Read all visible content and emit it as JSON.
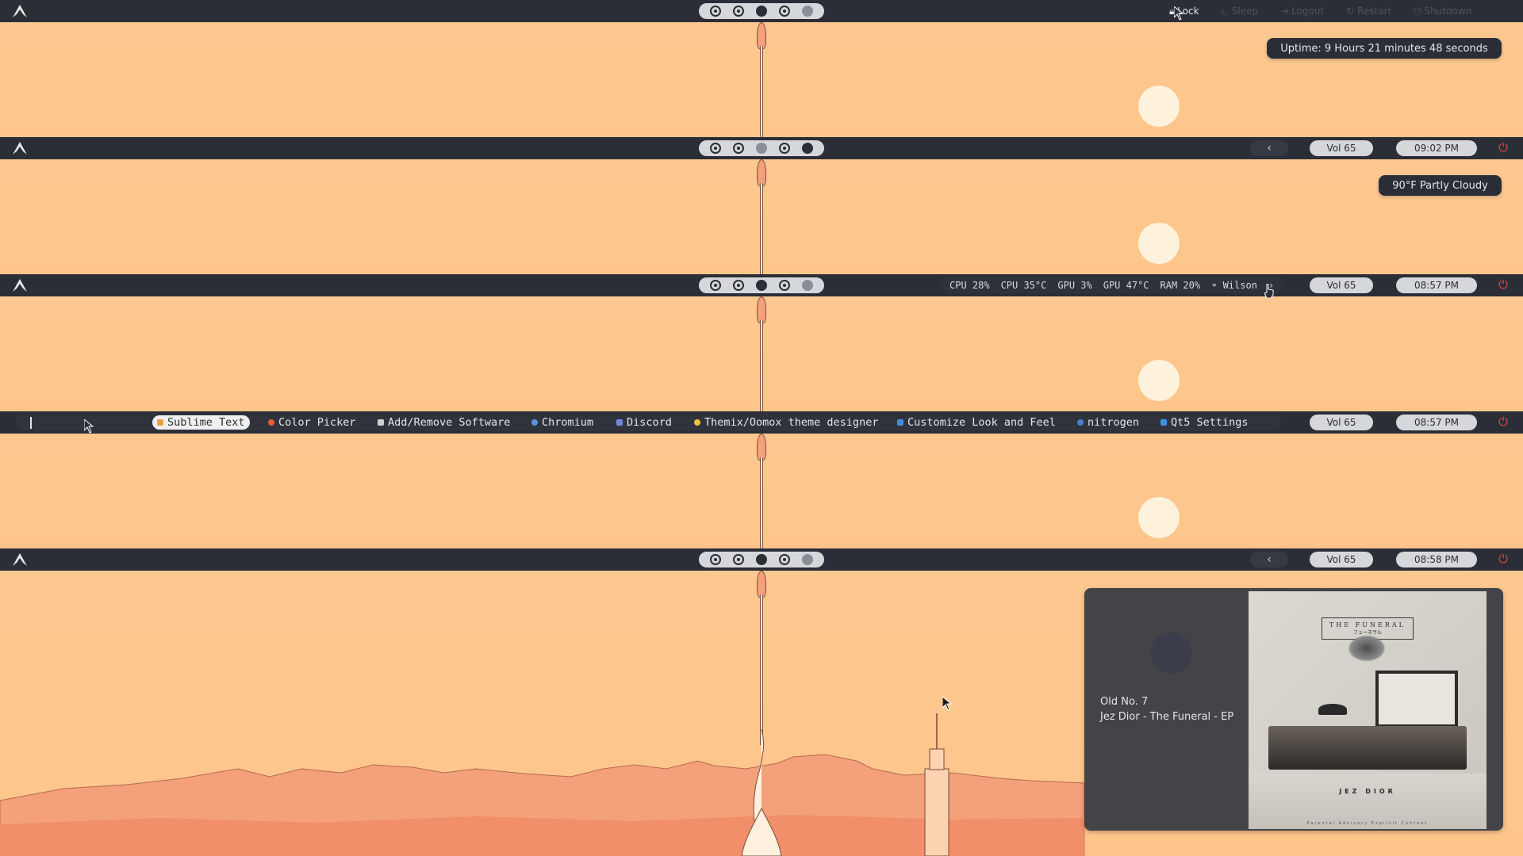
{
  "sys_menu": {
    "items": [
      {
        "icon": "lock-icon",
        "label": "Lock",
        "active": true
      },
      {
        "icon": "sleep-icon",
        "label": "Sleep"
      },
      {
        "icon": "logout-icon",
        "label": "Logout"
      },
      {
        "icon": "restart-icon",
        "label": "Restart"
      },
      {
        "icon": "shutdown-icon",
        "label": "Shutdown"
      }
    ]
  },
  "tooltips": {
    "uptime": "Uptime: 9 Hours 21 minutes 48 seconds",
    "weather": "90°F Partly Cloudy"
  },
  "bars": [
    {
      "volume": "Vol 65",
      "time": "09:02 PM"
    },
    {
      "volume": "Vol 65",
      "time": "08:57 PM"
    },
    {
      "volume": "Vol 65",
      "time": "08:57 PM"
    },
    {
      "volume": "Vol 65",
      "time": "08:58 PM"
    }
  ],
  "stats": {
    "cpu_usage": "CPU 28%",
    "cpu_temp": "CPU 35°C",
    "gpu_usage": "GPU 3%",
    "gpu_temp": "GPU 47°C",
    "ram": "RAM 20%",
    "wifi": "Wilson",
    "expand": "›"
  },
  "chevron": "‹",
  "tasks": [
    {
      "label": "Sublime Text",
      "color": "#e8a33a",
      "active": true
    },
    {
      "label": "Color Picker",
      "color": "#e85c3a"
    },
    {
      "label": "Add/Remove Software",
      "color": "#cfcfcf"
    },
    {
      "label": "Chromium",
      "color": "#5b8fe0"
    },
    {
      "label": "Discord",
      "color": "#7289da"
    },
    {
      "label": "Themix/Oomox theme designer",
      "color": "#f0c040"
    },
    {
      "label": "Customize Look and Feel",
      "color": "#3d8fe0"
    },
    {
      "label": "nitrogen",
      "color": "#4a7fd0"
    },
    {
      "label": "Qt5 Settings",
      "color": "#3d8fe0"
    }
  ],
  "media": {
    "song": "Old No. 7",
    "album": "Jez Dior - The Funeral - EP",
    "cover": {
      "title": "THE FUNERAL",
      "subtitle": "フューネラル",
      "artist": "JEZ DIOR",
      "footer": "Parental Advisory Explicit Content"
    }
  },
  "colors": {
    "bar": "#2b2e37",
    "pill": "#d6d7db",
    "power": "#e8473a",
    "sky": "#fdc98a"
  }
}
